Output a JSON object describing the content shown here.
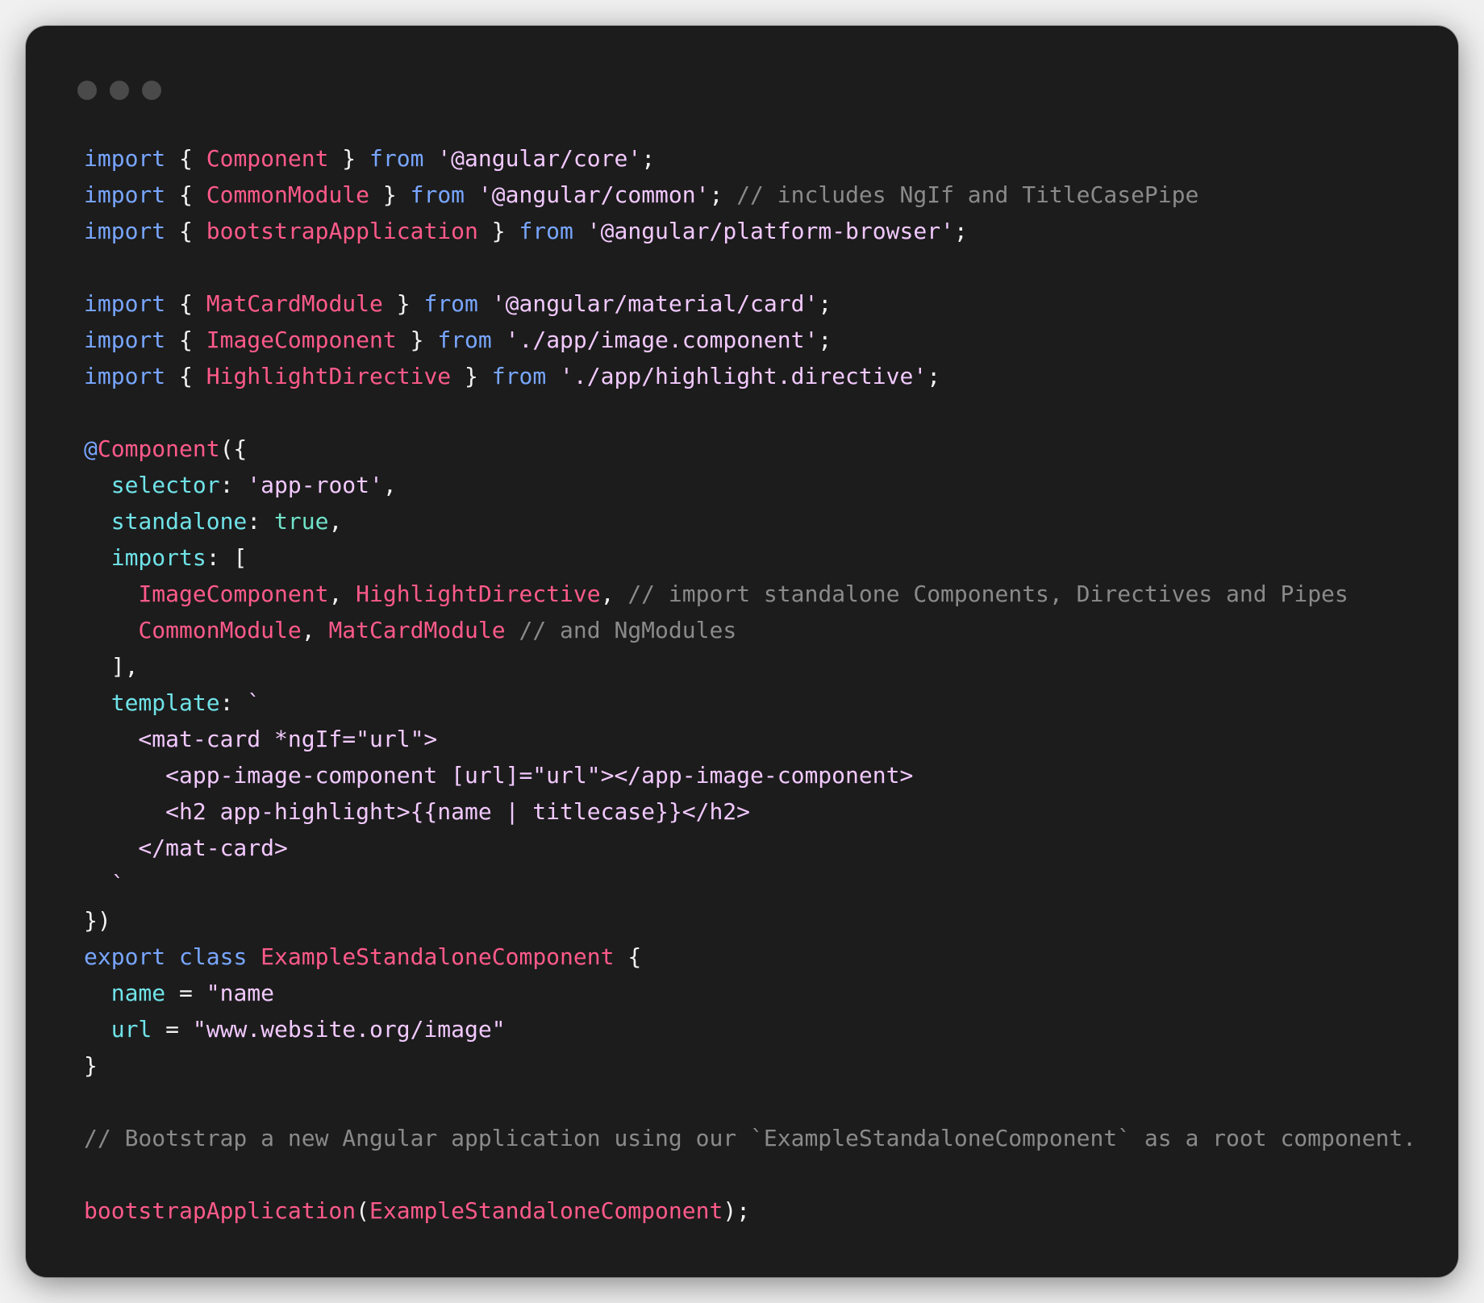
{
  "window": {
    "controls": [
      "close-dot",
      "minimize-dot",
      "zoom-dot"
    ]
  },
  "colors": {
    "background": "#1c1c1c",
    "keyword": "#78a6ff",
    "identifier": "#ff5a8a",
    "string": "#f2c9ff",
    "comment": "#8a8a8a",
    "property": "#6fe3e8"
  },
  "code": {
    "lines": [
      [
        [
          "keyword",
          "import"
        ],
        [
          "punct",
          " { "
        ],
        [
          "ident",
          "Component"
        ],
        [
          "punct",
          " } "
        ],
        [
          "keyword",
          "from"
        ],
        [
          "punct",
          " "
        ],
        [
          "string",
          "'@angular/core'"
        ],
        [
          "punct",
          ";"
        ]
      ],
      [
        [
          "keyword",
          "import"
        ],
        [
          "punct",
          " { "
        ],
        [
          "ident",
          "CommonModule"
        ],
        [
          "punct",
          " } "
        ],
        [
          "keyword",
          "from"
        ],
        [
          "punct",
          " "
        ],
        [
          "string",
          "'@angular/common'"
        ],
        [
          "punct",
          "; "
        ],
        [
          "comment",
          "// includes NgIf and TitleCasePipe"
        ]
      ],
      [
        [
          "keyword",
          "import"
        ],
        [
          "punct",
          " { "
        ],
        [
          "ident",
          "bootstrapApplication"
        ],
        [
          "punct",
          " } "
        ],
        [
          "keyword",
          "from"
        ],
        [
          "punct",
          " "
        ],
        [
          "string",
          "'@angular/platform-browser'"
        ],
        [
          "punct",
          ";"
        ]
      ],
      [],
      [
        [
          "keyword",
          "import"
        ],
        [
          "punct",
          " { "
        ],
        [
          "ident",
          "MatCardModule"
        ],
        [
          "punct",
          " } "
        ],
        [
          "keyword",
          "from"
        ],
        [
          "punct",
          " "
        ],
        [
          "string",
          "'@angular/material/card'"
        ],
        [
          "punct",
          ";"
        ]
      ],
      [
        [
          "keyword",
          "import"
        ],
        [
          "punct",
          " { "
        ],
        [
          "ident",
          "ImageComponent"
        ],
        [
          "punct",
          " } "
        ],
        [
          "keyword",
          "from"
        ],
        [
          "punct",
          " "
        ],
        [
          "string",
          "'./app/image.component'"
        ],
        [
          "punct",
          ";"
        ]
      ],
      [
        [
          "keyword",
          "import"
        ],
        [
          "punct",
          " { "
        ],
        [
          "ident",
          "HighlightDirective"
        ],
        [
          "punct",
          " } "
        ],
        [
          "keyword",
          "from"
        ],
        [
          "punct",
          " "
        ],
        [
          "string",
          "'./app/highlight.directive'"
        ],
        [
          "punct",
          ";"
        ]
      ],
      [],
      [
        [
          "decor",
          "@"
        ],
        [
          "ident",
          "Component"
        ],
        [
          "punct",
          "({"
        ]
      ],
      [
        [
          "punct",
          "  "
        ],
        [
          "prop",
          "selector"
        ],
        [
          "punct",
          ": "
        ],
        [
          "string",
          "'app-root'"
        ],
        [
          "punct",
          ","
        ]
      ],
      [
        [
          "punct",
          "  "
        ],
        [
          "prop",
          "standalone"
        ],
        [
          "punct",
          ": "
        ],
        [
          "bool",
          "true"
        ],
        [
          "punct",
          ","
        ]
      ],
      [
        [
          "punct",
          "  "
        ],
        [
          "prop",
          "imports"
        ],
        [
          "punct",
          ": ["
        ]
      ],
      [
        [
          "punct",
          "    "
        ],
        [
          "ident",
          "ImageComponent"
        ],
        [
          "punct",
          ", "
        ],
        [
          "ident",
          "HighlightDirective"
        ],
        [
          "punct",
          ", "
        ],
        [
          "comment",
          "// import standalone Components, Directives and Pipes"
        ]
      ],
      [
        [
          "punct",
          "    "
        ],
        [
          "ident",
          "CommonModule"
        ],
        [
          "punct",
          ", "
        ],
        [
          "ident",
          "MatCardModule"
        ],
        [
          "punct",
          " "
        ],
        [
          "comment",
          "// and NgModules"
        ]
      ],
      [
        [
          "punct",
          "  ],"
        ]
      ],
      [
        [
          "punct",
          "  "
        ],
        [
          "prop",
          "template"
        ],
        [
          "punct",
          ": "
        ],
        [
          "tmpl",
          "`"
        ]
      ],
      [
        [
          "tmpl",
          "    <mat-card *ngIf=\"url\">"
        ]
      ],
      [
        [
          "tmpl",
          "      <app-image-component [url]=\"url\"></app-image-component>"
        ]
      ],
      [
        [
          "tmpl",
          "      <h2 app-highlight>{{name | titlecase}}</h2>"
        ]
      ],
      [
        [
          "tmpl",
          "    </mat-card>"
        ]
      ],
      [
        [
          "tmpl",
          "  `"
        ]
      ],
      [
        [
          "punct",
          "})"
        ]
      ],
      [
        [
          "keyword",
          "export"
        ],
        [
          "punct",
          " "
        ],
        [
          "keyword",
          "class"
        ],
        [
          "punct",
          " "
        ],
        [
          "ident",
          "ExampleStandaloneComponent"
        ],
        [
          "punct",
          " {"
        ]
      ],
      [
        [
          "punct",
          "  "
        ],
        [
          "prop",
          "name"
        ],
        [
          "punct",
          " = "
        ],
        [
          "string",
          "\"name"
        ]
      ],
      [
        [
          "punct",
          "  "
        ],
        [
          "prop",
          "url"
        ],
        [
          "punct",
          " = "
        ],
        [
          "string",
          "\"www.website.org/image\""
        ]
      ],
      [
        [
          "punct",
          "}"
        ]
      ],
      [],
      [
        [
          "comment",
          "// Bootstrap a new Angular application using our `ExampleStandaloneComponent` as a root component."
        ]
      ],
      [],
      [
        [
          "ident",
          "bootstrapApplication"
        ],
        [
          "punct",
          "("
        ],
        [
          "ident",
          "ExampleStandaloneComponent"
        ],
        [
          "punct",
          ");"
        ]
      ]
    ]
  }
}
